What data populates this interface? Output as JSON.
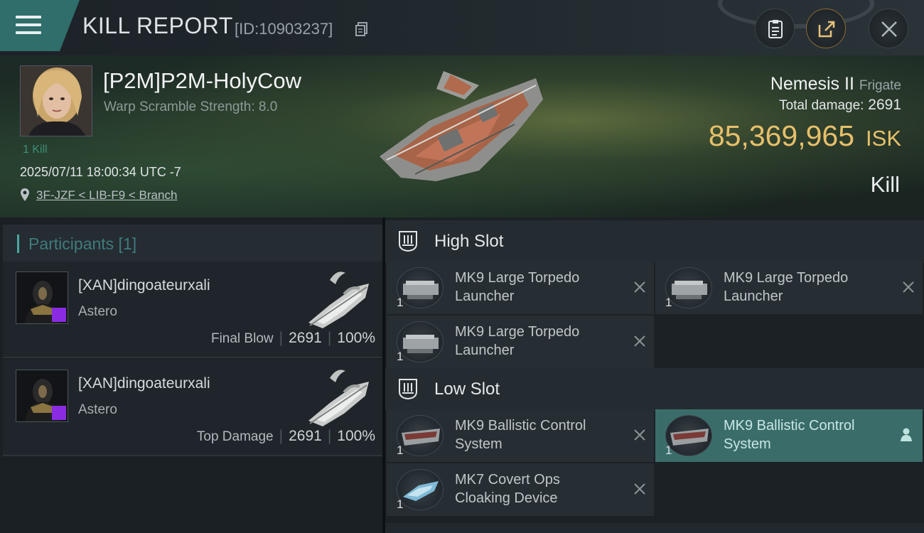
{
  "header": {
    "title": "KILL REPORT",
    "report_id": "[ID:10903237]",
    "icons": [
      "menu-icon",
      "copy-icon",
      "clipboard-icon",
      "share-icon",
      "close-icon"
    ]
  },
  "victim": {
    "name": "[P2M]P2M-HolyCow",
    "warp_scramble": "Warp Scramble Strength: 8.0",
    "kill_count": "1 Kill",
    "datetime": "2025/07/11 18:00:34 UTC -7",
    "location": "3F-JZF < LIB-F9 < Branch",
    "ship_name": "Nemesis II",
    "ship_class": "Frigate",
    "total_damage_label": "Total damage:",
    "total_damage": "2691",
    "isk_value": "85,369,965",
    "isk_unit": "ISK",
    "kill_type": "Kill"
  },
  "participants": {
    "title": "Participants [1]",
    "rows": [
      {
        "name": "[XAN]dingoateurxali",
        "ship": "Astero",
        "role": "Final Blow",
        "damage": "2691",
        "percent": "100%"
      },
      {
        "name": "[XAN]dingoateurxali",
        "ship": "Astero",
        "role": "Top Damage",
        "damage": "2691",
        "percent": "100%"
      }
    ]
  },
  "slots": {
    "high": {
      "title": "High Slot",
      "modules": [
        {
          "name_line1": "MK9 Large Torpedo",
          "name_line2": "Launcher",
          "qty": "1"
        },
        {
          "name_line1": "MK9 Large Torpedo",
          "name_line2": "Launcher",
          "qty": "1"
        },
        {
          "name_line1": "MK9 Large Torpedo",
          "name_line2": "Launcher",
          "qty": "1"
        }
      ]
    },
    "low": {
      "title": "Low Slot",
      "modules": [
        {
          "name_line1": "MK9 Ballistic Control",
          "name_line2": "System",
          "qty": "1"
        },
        {
          "name_line1": "MK9 Ballistic Control",
          "name_line2": "System",
          "qty": "1"
        },
        {
          "name_line1": "MK7 Covert Ops",
          "name_line2": "Cloaking Device",
          "qty": "1"
        }
      ]
    }
  },
  "colors": {
    "accent_teal": "#3a6d6a",
    "isk_gold": "#e7c06a",
    "badge_purple": "#8a2be2"
  }
}
